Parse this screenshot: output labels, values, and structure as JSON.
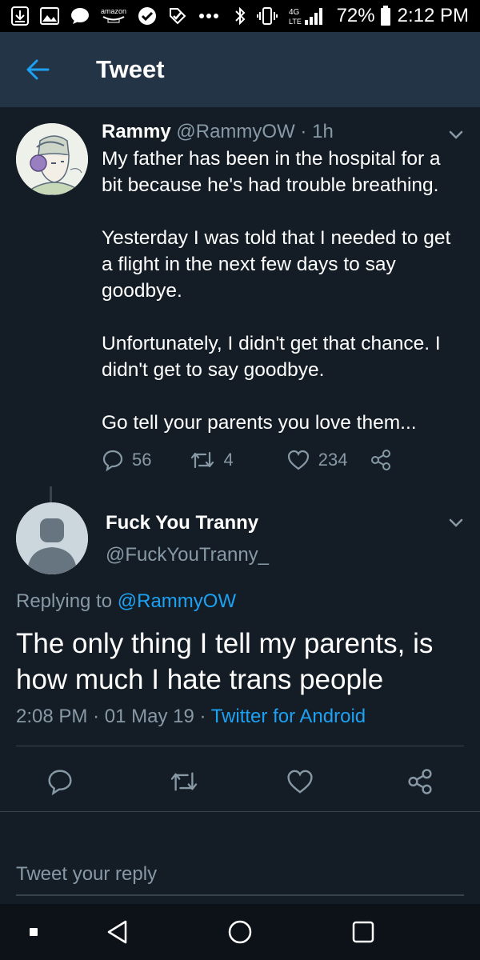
{
  "status_bar": {
    "amazon_label": "amazon",
    "network": "4G LTE",
    "battery": "72%",
    "time": "2:12 PM"
  },
  "header": {
    "title": "Tweet",
    "back_icon": "arrow-left-icon"
  },
  "original_tweet": {
    "name": "Rammy",
    "handle": "@RammyOW",
    "separator": "·",
    "age": "1h",
    "text": "My father has been in the hospital for a bit because he's had trouble breathing.\n\nYesterday I was told that I needed to get a flight in the next few days to say goodbye.\n\nUnfortunately, I didn't get that chance. I didn't get to say goodbye.\n\nGo tell your parents you love them...",
    "reply_count": "56",
    "retweet_count": "4",
    "like_count": "234"
  },
  "reply_tweet": {
    "name": "Fuck You Tranny",
    "handle": "@FuckYouTranny_",
    "replying_prefix": "Replying to",
    "replying_to": "@RammyOW",
    "text": "The only thing I tell my parents, is how much I hate trans people",
    "time": "2:08 PM",
    "separator": "·",
    "date": "01 May 19",
    "client": "Twitter for Android"
  },
  "reply_box": {
    "placeholder": "Tweet your reply"
  },
  "colors": {
    "background": "#141d26",
    "header": "#243447",
    "accent": "#1da1f2",
    "muted": "#8899a6",
    "divider": "#38444d"
  }
}
